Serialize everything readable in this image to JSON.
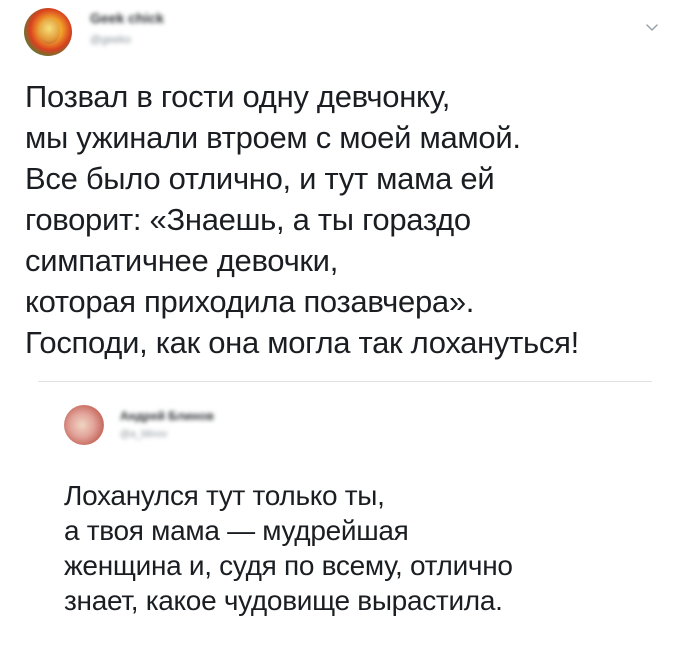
{
  "main_tweet": {
    "author_name": "Geek chick",
    "author_handle": "@geeko",
    "text": "Позвал в гости одну девчонку,\nмы ужинали втроем с моей мамой.\nВсе было отлично, и тут мама ей\nговорит: «Знаешь, а ты гораздо\nсимпатичнее девочки,\nкоторая приходила позавчера».\nГосподи, как она могла так лохануться!"
  },
  "reply_tweet": {
    "author_name": "Андрей Блинов",
    "author_handle": "@a_blinov",
    "text": "Лоханулся тут только ты,\nа твоя мама — мудрейшая\nженщина и, судя по всему, отлично\nзнает, какое чудовище вырастила."
  },
  "icons": {
    "menu": "chevron-down-icon"
  },
  "colors": {
    "text": "#1a1e22",
    "muted": "#8a949c",
    "divider": "#dfe3e6"
  }
}
